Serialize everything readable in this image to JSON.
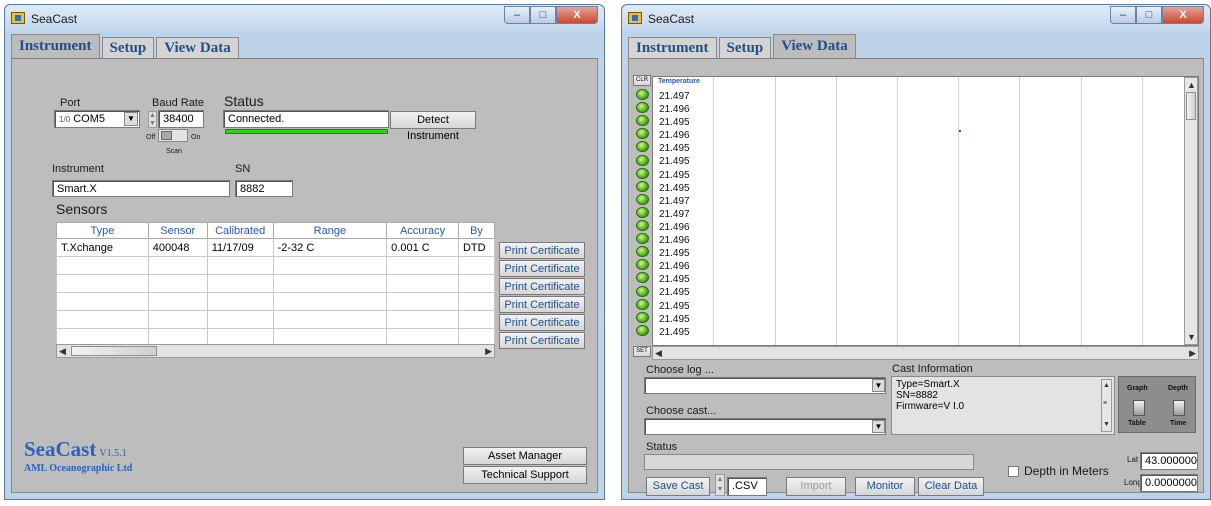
{
  "left_window": {
    "title": "SeaCast",
    "controls": {
      "minimize": "–",
      "maximize": "□",
      "close": "X"
    },
    "tabs": [
      {
        "label": "Instrument",
        "active": true
      },
      {
        "label": "Setup",
        "active": false
      },
      {
        "label": "View Data",
        "active": false
      }
    ],
    "port_label": "Port",
    "port_value": "COM5",
    "port_prefix": "1/0",
    "baud_label": "Baud Rate",
    "baud_value": "38400",
    "scan_off": "Off",
    "scan_on": "On",
    "scan_label": "Scan",
    "status_label": "Status",
    "status_value": "Connected.",
    "detect_button": "Detect Instrument",
    "instrument_label": "Instrument",
    "instrument_value": "Smart.X",
    "sn_label": "SN",
    "sn_value": "8882",
    "sensors_label": "Sensors",
    "sensor_columns": [
      "Type",
      "Sensor",
      "Calibrated",
      "Range",
      "Accuracy",
      "By"
    ],
    "sensor_rows": [
      [
        "T.Xchange",
        "400048",
        "11/17/09",
        "-2-32 C",
        "0.001 C",
        "DTD"
      ],
      [
        "",
        "",
        "",
        "",
        "",
        ""
      ],
      [
        "",
        "",
        "",
        "",
        "",
        ""
      ],
      [
        "",
        "",
        "",
        "",
        "",
        ""
      ],
      [
        "",
        "",
        "",
        "",
        "",
        ""
      ],
      [
        "",
        "",
        "",
        "",
        "",
        ""
      ]
    ],
    "print_buttons": [
      "Print Certificate",
      "Print Certificate",
      "Print Certificate",
      "Print Certificate",
      "Print Certificate",
      "Print Certificate"
    ],
    "logo_name": "SeaCast",
    "logo_version": "V1.5.1",
    "logo_company": "AML Oceanographic Ltd",
    "asset_button": "Asset Manager",
    "support_button": "Technical Support"
  },
  "right_window": {
    "title": "SeaCast",
    "controls": {
      "minimize": "–",
      "maximize": "□",
      "close": "X"
    },
    "tabs": [
      {
        "label": "Instrument",
        "active": false
      },
      {
        "label": "Setup",
        "active": false
      },
      {
        "label": "View Data",
        "active": true
      }
    ],
    "clr_label": "CLR",
    "set_label": "SET",
    "column_header": "Temperature",
    "temperatures": [
      "21.497",
      "21.496",
      "21.495",
      "21.496",
      "21.495",
      "21.495",
      "21.495",
      "21.495",
      "21.497",
      "21.497",
      "21.496",
      "21.496",
      "21.495",
      "21.496",
      "21.495",
      "21.495",
      "21.495",
      "21.495",
      "21.495"
    ],
    "choose_log_label": "Choose log ...",
    "choose_log_value": "",
    "choose_cast_label": "Choose cast...",
    "choose_cast_value": "",
    "cast_info_label": "Cast Information",
    "cast_info_lines": [
      "Type=Smart.X",
      "SN=8882",
      "Firmware=V I.0"
    ],
    "graph_label": "Graph",
    "depth_label": "Depth",
    "table_label": "Table",
    "time_label": "Time",
    "status_label": "Status",
    "status_value": "",
    "depth_meters_label": "Depth in Meters",
    "lat_label": "Lat",
    "lat_value": "43.0000000",
    "long_label": "Long",
    "long_value": "0.0000000",
    "save_cast_button": "Save Cast",
    "format_value": ".CSV",
    "import_button": "Import",
    "monitor_button": "Monitor",
    "clear_data_button": "Clear Data"
  }
}
